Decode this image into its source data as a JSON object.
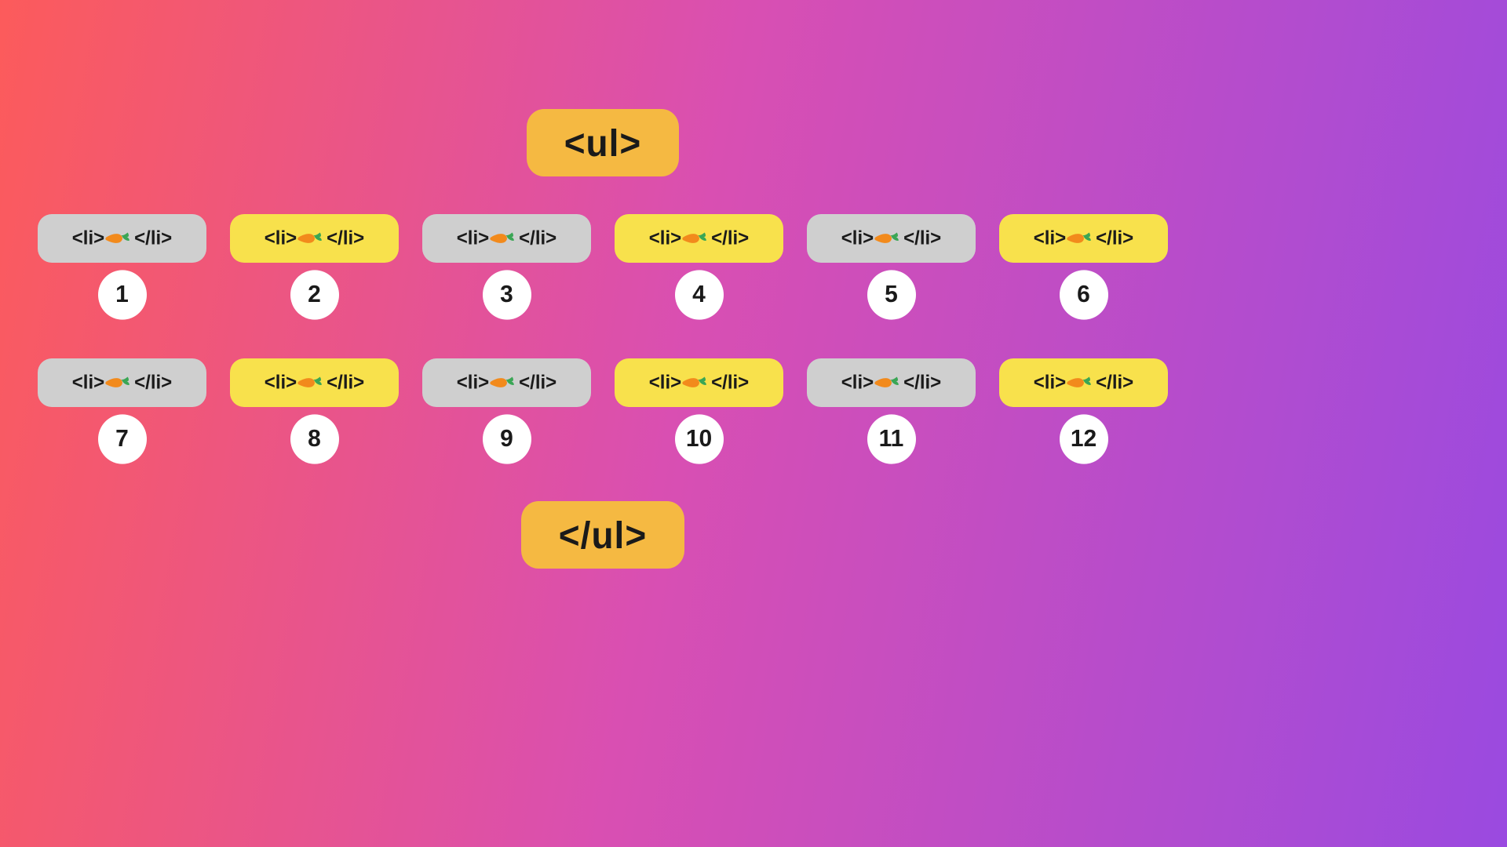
{
  "header": {
    "open_tag": "<ul>",
    "close_tag": "</ul>"
  },
  "li_label": {
    "open": "<li>",
    "close": "</li>"
  },
  "colors": [
    "grey",
    "yellow",
    "grey",
    "yellow",
    "grey",
    "yellow",
    "grey",
    "yellow",
    "grey",
    "yellow",
    "grey",
    "yellow"
  ],
  "items": [
    {
      "index": 1
    },
    {
      "index": 2
    },
    {
      "index": 3
    },
    {
      "index": 4
    },
    {
      "index": 5
    },
    {
      "index": 6
    },
    {
      "index": 7
    },
    {
      "index": 8
    },
    {
      "index": 9
    },
    {
      "index": 10
    },
    {
      "index": 11
    },
    {
      "index": 12
    }
  ]
}
